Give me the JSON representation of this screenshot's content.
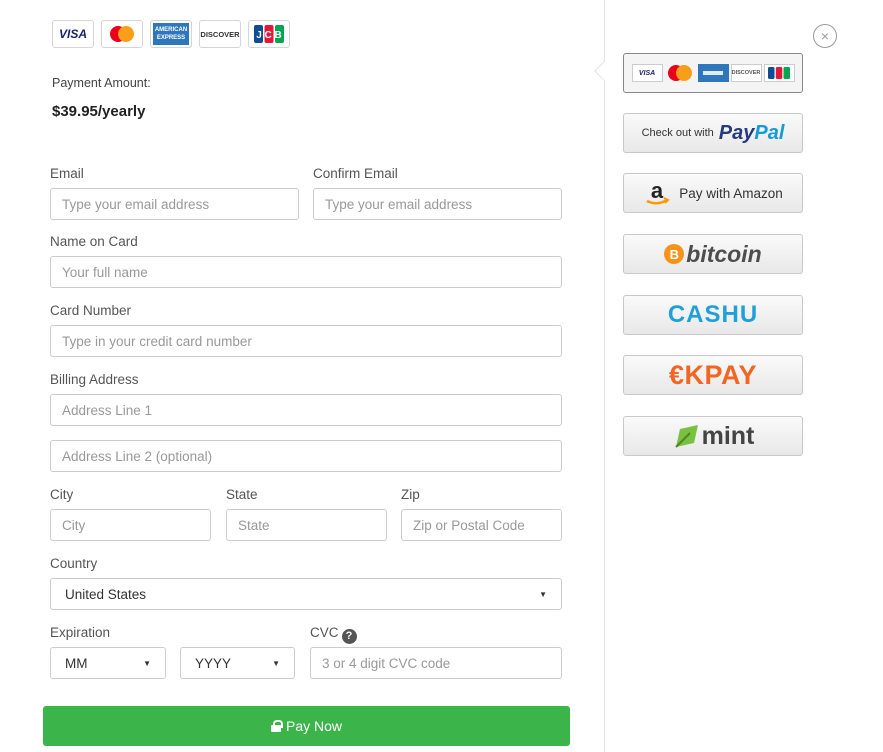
{
  "card_logos": {
    "visa": "VISA",
    "mastercard": "MasterCard",
    "amex": "AMERICAN EXPRESS",
    "discover": "DISCOVER",
    "jcb": "JCB"
  },
  "payment": {
    "label": "Payment Amount:",
    "amount": "$39.95/yearly"
  },
  "form": {
    "email": {
      "label": "Email",
      "placeholder": "Type your email address"
    },
    "confirm_email": {
      "label": "Confirm Email",
      "placeholder": "Type your email address"
    },
    "name": {
      "label": "Name on Card",
      "placeholder": "Your full name"
    },
    "card_number": {
      "label": "Card Number",
      "placeholder": "Type in your credit card number"
    },
    "billing": {
      "label": "Billing Address",
      "line1_placeholder": "Address Line 1",
      "line2_placeholder": "Address Line 2 (optional)"
    },
    "city": {
      "label": "City",
      "placeholder": "City"
    },
    "state": {
      "label": "State",
      "placeholder": "State"
    },
    "zip": {
      "label": "Zip",
      "placeholder": "Zip or Postal Code"
    },
    "country": {
      "label": "Country",
      "value": "United States"
    },
    "expiration": {
      "label": "Expiration",
      "month": "MM",
      "year": "YYYY"
    },
    "cvc": {
      "label": "CVC",
      "placeholder": "3 or 4 digit CVC code",
      "help": "?"
    },
    "submit_label": "Pay Now"
  },
  "methods": {
    "close": "×",
    "paypal": {
      "prefix": "Check out with",
      "pay": "Pay",
      "pal": "Pal"
    },
    "amazon": {
      "icon": "a",
      "label": "Pay with Amazon"
    },
    "bitcoin": {
      "icon": "B",
      "label": "bitcoin"
    },
    "cashu": {
      "label": "CASHU"
    },
    "okpay": {
      "label": "€KPAY"
    },
    "mint": {
      "label": "mint"
    }
  },
  "colors": {
    "pay_button": "#3bb54a",
    "paypal_dark": "#253b80",
    "paypal_light": "#179bd7",
    "bitcoin": "#f7931a",
    "okpay": "#f26522",
    "cashu": "#1fa0d8"
  }
}
